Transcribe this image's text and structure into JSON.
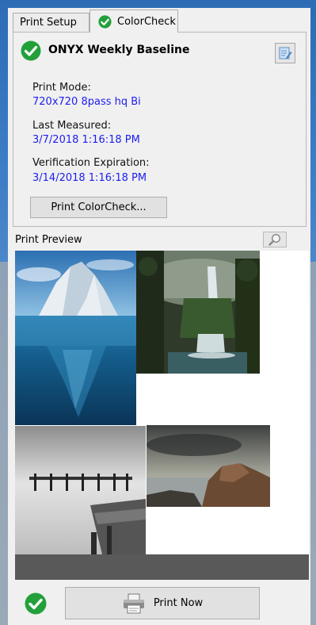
{
  "tabs": [
    {
      "label": "Print Setup"
    },
    {
      "label": "ColorCheck",
      "active": true
    }
  ],
  "panel": {
    "title": "ONYX Weekly Baseline",
    "fields": {
      "print_mode": {
        "label": "Print Mode:",
        "value": "720x720 8pass hq Bi"
      },
      "last_measured": {
        "label": "Last Measured:",
        "value": "3/7/2018 1:16:18 PM"
      },
      "verification_expiration": {
        "label": "Verification Expiration:",
        "value": "3/14/2018 1:16:18 PM"
      }
    },
    "print_colorcheck_label": "Print ColorCheck..."
  },
  "preview": {
    "label": "Print Preview"
  },
  "footer": {
    "print_now_label": "Print Now"
  },
  "colors": {
    "value_text": "#1d1df0",
    "check_green": "#23a03a",
    "preview_footer": "#595959"
  },
  "icons": [
    "check-circle-icon",
    "edit-icon",
    "magnifier-icon",
    "printer-icon"
  ]
}
